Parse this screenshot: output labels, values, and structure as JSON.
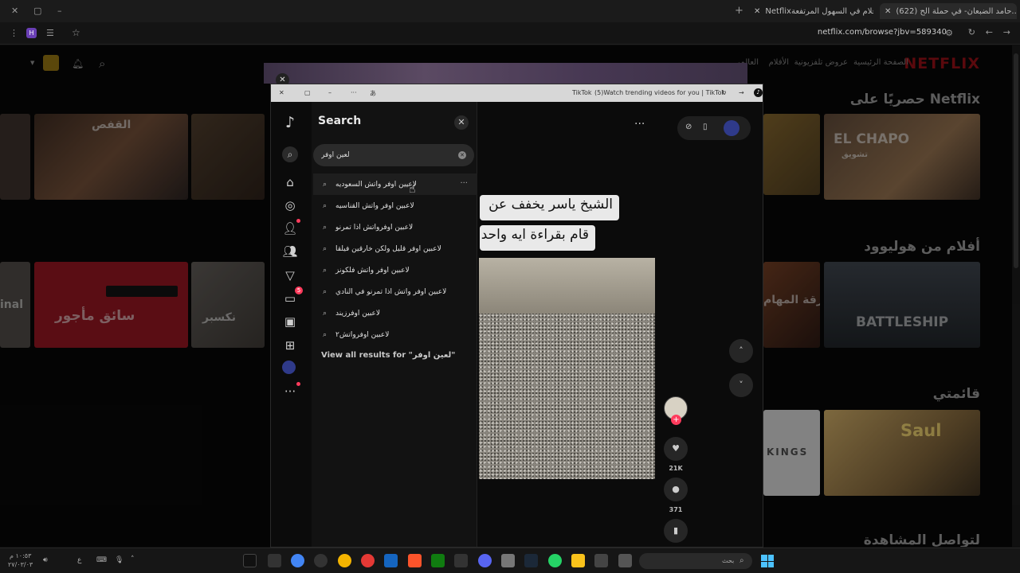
{
  "browser": {
    "tabs": [
      {
        "title": "(622) حامد الضبعان- في حملة الح..."
      },
      {
        "title": "Netflixأفلام في السهول المرتفعة"
      }
    ],
    "url": "netflix.com/browse?jbv=589340",
    "profile_initial": "H"
  },
  "netflix": {
    "logo": "NETFLIX",
    "nav": [
      "الصفحة الرئيسية",
      "عروض تلفزيونية",
      "الأفلام",
      "العالمي"
    ],
    "rows": [
      {
        "title": "حصريًا على Netflix"
      },
      {
        "title": "أفلام من هوليوود"
      },
      {
        "title": "قائمتي"
      },
      {
        "title": "لتواصل المشاهدة"
      }
    ],
    "cards": {
      "cage": "القفص",
      "chapo": "EL CHAPO",
      "chapo_sub": "تشويق",
      "driver": "سائق مأجور",
      "battleship": "BATTLESHIP",
      "kings": "KINGS",
      "saul": "Saul",
      "top10_team": "فرقة المهام",
      "partial_left": "inal",
      "partial_mid": "نكسبر"
    }
  },
  "tiktok_window": {
    "title": "(5)Watch trending videos for you | TikTok",
    "app_name": "TikTok",
    "sidebar": {
      "message_badge": "5"
    },
    "search": {
      "header": "Search",
      "query": "لعين اوفر",
      "suggestions": [
        "لاعيين اوفر واتش السعوديه",
        "لاعبين اوفر واتش القناسيه",
        "لاعبين اوفرواتش اذا تمرنو",
        "لاعبين اوفر قليل ولكن خارقين فيلقا",
        "لاعبين اوفر واتش فلكونز",
        "لاعبين اوفر واتش اذا تمرنو في النادي",
        "لاعبين اوفرزيند",
        "لاعبين اوفرواتش٢"
      ],
      "view_all": "View all results for \"لعين اوفر\""
    },
    "video": {
      "caption_line1": "الشيخ ياسر يخفف عن",
      "caption_line2": "قام بقراءة ايه واحد",
      "likes": "21K",
      "comments": "371"
    }
  },
  "taskbar": {
    "time": "١٠:٥٣ م",
    "date": "٢٧/٠٣/٠٣",
    "lang": "ع",
    "search_placeholder": "بحث"
  },
  "colors": {
    "accent": "#ff3b5c",
    "netflix_red": "#e50914",
    "panel": "#121212"
  }
}
